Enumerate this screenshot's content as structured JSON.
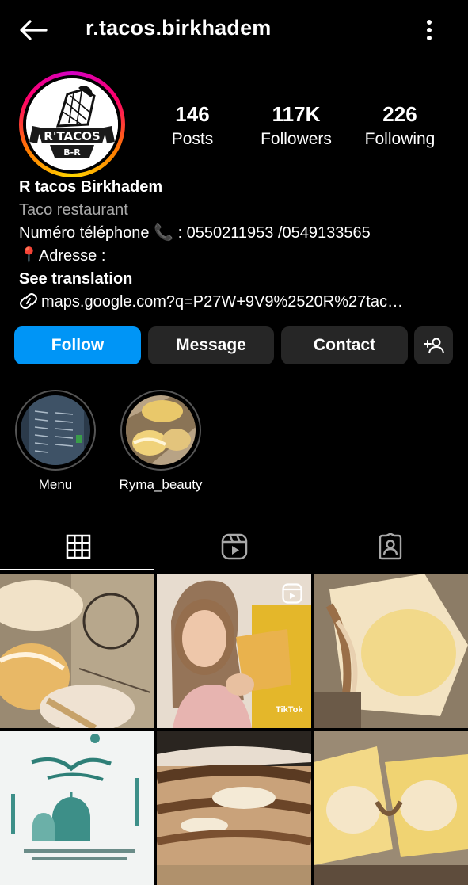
{
  "header": {
    "username": "r.tacos.birkhadem"
  },
  "profile": {
    "avatar_text_main": "R'TACOS",
    "avatar_text_sub": "B-R",
    "stats": [
      {
        "value": "146",
        "label": "Posts"
      },
      {
        "value": "117K",
        "label": "Followers"
      },
      {
        "value": "226",
        "label": "Following"
      }
    ],
    "name": "R tacos Birkhadem",
    "category": "Taco restaurant",
    "bio_line1": "Numéro téléphone 📞 : 0550211953 /0549133565",
    "bio_line2": "📍Adresse :",
    "see_translation": "See translation",
    "link": "maps.google.com?q=P27W+9V9%2520R%27tac…"
  },
  "actions": {
    "follow": "Follow",
    "message": "Message",
    "contact": "Contact"
  },
  "highlights": [
    {
      "label": "Menu"
    },
    {
      "label": "Ryma_beauty"
    }
  ],
  "tabs": [
    "grid-icon",
    "reels-icon",
    "tagged-icon"
  ],
  "posts": [
    {
      "type": "photo"
    },
    {
      "type": "reel",
      "watermark": "TikTok"
    },
    {
      "type": "photo"
    },
    {
      "type": "photo"
    },
    {
      "type": "photo"
    },
    {
      "type": "photo"
    }
  ],
  "colors": {
    "background": "#000000",
    "primary_button": "#0095f6",
    "secondary_button": "#262626",
    "muted_text": "#a8a8a8"
  }
}
